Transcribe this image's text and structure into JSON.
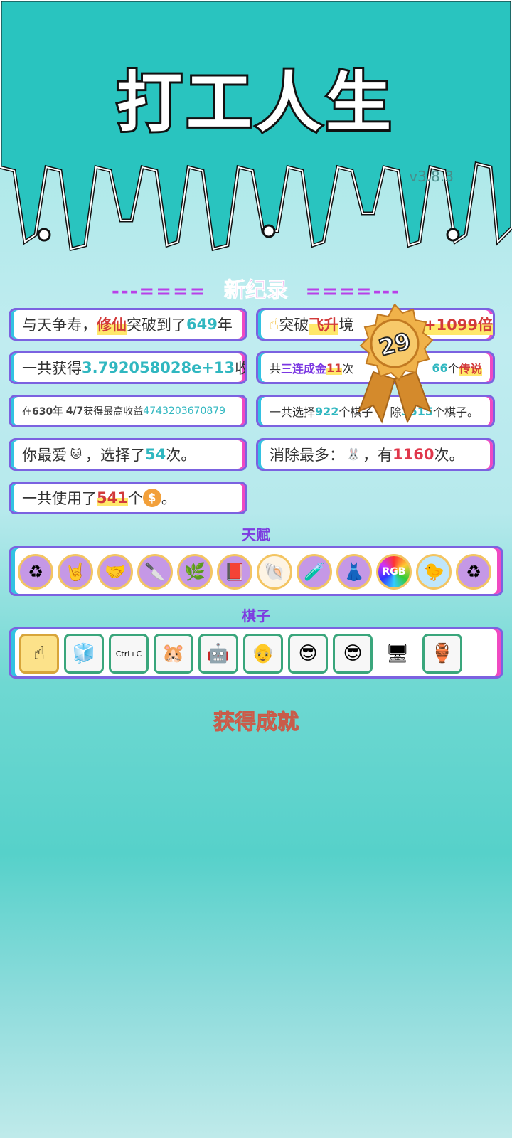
{
  "app": {
    "title": "打工人生",
    "version": "v3.8.3"
  },
  "records_banner": {
    "dashes_left": "---====",
    "label": "新纪录",
    "dashes_right": "====---"
  },
  "records": {
    "cultivation": {
      "pre": "与天争寿，",
      "hl": "修仙",
      "mid": "突破到了",
      "num": "649",
      "post": "年"
    },
    "ascension": {
      "pre": "突破",
      "hl": "飞升",
      "mid": "境",
      "num": "+1099倍"
    },
    "total_income": {
      "pre": "一共获得",
      "num": "3.792058028e+13",
      "post": "收益"
    },
    "triple": {
      "pre": "共",
      "hl": "三连成金",
      "num": "11",
      "post": "次",
      "num2": "66",
      "post2": "个",
      "hl2": "传说"
    },
    "max_income": {
      "pre": "在 ",
      "year": "630年",
      "date": "4/7",
      "mid": " 获得最高收益",
      "num": "4743203670879"
    },
    "pieces": {
      "pre": "一共选择",
      "num": "922",
      "mid": "个棋子",
      "mid2": "除",
      "num2": "3515",
      "post": "个棋子。"
    },
    "favorite": {
      "pre": "你最爱",
      "icon": "cat-icon",
      "mid": "，选择了",
      "num": "54",
      "post": "次。"
    },
    "most_removed": {
      "pre": "消除最多：",
      "icon": "rabbit-icon",
      "mid": "，有",
      "num": "1160",
      "post": "次。"
    },
    "coins": {
      "pre": "一共使用了",
      "num": "541",
      "post": "个",
      "icon": "coin-icon",
      "end": "。"
    }
  },
  "medal": {
    "number": "29"
  },
  "talents_title": "天赋",
  "talents": [
    "recycle-icon",
    "rock-hand-icon",
    "handshake-icon",
    "knife-icon",
    "plant-icon",
    "time-magazine-icon",
    "shell-icon",
    "potion-icon",
    "skirt-icon",
    "rgb-icon",
    "bird-icon",
    "recycle-icon"
  ],
  "pieces_title": "棋子",
  "piece_items": [
    "pointer-hand-icon",
    "fridge-icon",
    "copy-paste-icon",
    "hamster-icon",
    "robot-worker-icon",
    "old-man-icon",
    "green-hair-man-icon",
    "green-hair-man-icon",
    "gpu-icon",
    "green-vase-icon"
  ],
  "achievements_label": "获得成就"
}
